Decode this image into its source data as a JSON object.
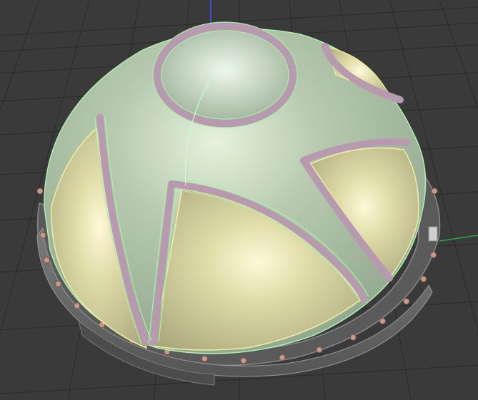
{
  "viewport": {
    "background": "#3a3a3a",
    "grid_color": "#2a2a2a",
    "axis_colors": {
      "x": "#22aa44",
      "y": "#3355ff"
    }
  },
  "model": {
    "type": "dome-shell",
    "shell_color": "#a8bba0",
    "panel_color": "#d0cc96",
    "trim_color": "#b89ab0",
    "edge_highlight": "#a8f0a8",
    "ring_color": "#6a6a6a",
    "rivet_color": "#c99a88",
    "rivet_count": 16
  }
}
